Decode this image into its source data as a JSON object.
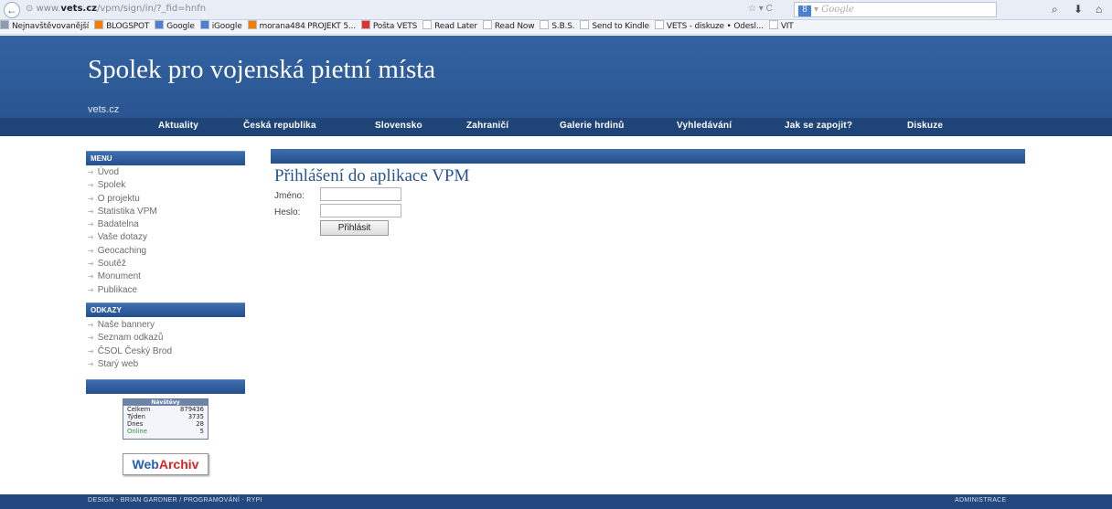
{
  "browser": {
    "back_glyph": "←",
    "url_prefix": "www.",
    "url_domain": "vets.cz",
    "url_rest": "/vpm/sign/in/?_fid=hnfn",
    "search_placeholder": "Google",
    "search_engine_glyph": "8",
    "star_icon": "star-icon",
    "reload_icon": "reload-icon",
    "bookmarks": [
      {
        "label": "Nejnavštěvovanější",
        "icon": "bookmarks-icon",
        "color": "#8a9bb5"
      },
      {
        "label": "BLOGSPOT",
        "icon": "blogger-icon",
        "color": "#f57d00"
      },
      {
        "label": "Google",
        "icon": "google-icon",
        "color": "#4c7fd6"
      },
      {
        "label": "iGoogle",
        "icon": "google-icon",
        "color": "#4c7fd6"
      },
      {
        "label": "morana484 PROJEKT 5...",
        "icon": "blogger-icon",
        "color": "#f57d00"
      },
      {
        "label": "Pošta VETS",
        "icon": "gmail-icon",
        "color": "#d33"
      },
      {
        "label": "Read Later",
        "icon": "page-icon",
        "color": "#ffffff"
      },
      {
        "label": "Read Now",
        "icon": "page-icon",
        "color": "#ffffff"
      },
      {
        "label": "S.B.S.",
        "icon": "page-icon",
        "color": "#ffffff"
      },
      {
        "label": "Send to Kindle",
        "icon": "page-icon",
        "color": "#ffffff"
      },
      {
        "label": "VETS - diskuze • Odesl...",
        "icon": "page-icon",
        "color": "#ffffff"
      },
      {
        "label": "VIT",
        "icon": "page-icon",
        "color": "#ffffff"
      }
    ]
  },
  "site": {
    "title": "Spolek pro vojenská pietní místa",
    "url": "vets.cz",
    "nav": [
      "Aktuality",
      "Česká republika",
      "Slovensko",
      "Zahraničí",
      "Galerie hrdinů",
      "Vyhledávání",
      "Jak se zapojit?",
      "Diskuze"
    ]
  },
  "sidebar": {
    "menu_title": "MENU",
    "menu_items": [
      "Úvod",
      "Spolek",
      "O projektu",
      "Statistika VPM",
      "Badatelna",
      "Vaše dotazy",
      "Geocaching",
      "Soutěž",
      "Monument",
      "Publikace"
    ],
    "links_title": "ODKAZY",
    "link_items": [
      "Naše bannery",
      "Seznam odkazů",
      "ČSOL Český Brod",
      "Starý web"
    ],
    "counter": {
      "title": "Návštěvy",
      "rows": [
        {
          "label": "Celkem",
          "value": "879436"
        },
        {
          "label": "Týden",
          "value": "3735"
        },
        {
          "label": "Dnes",
          "value": "28"
        },
        {
          "label": "Online",
          "value": "5"
        }
      ]
    },
    "webarchiv": {
      "part1": "Web",
      "part2": "Archiv"
    }
  },
  "main": {
    "title": "Přihlášení do aplikace VPM",
    "username_label": "Jméno:",
    "password_label": "Heslo:",
    "username_value": "",
    "password_value": "",
    "submit_label": "Přihlásit"
  },
  "footer": {
    "credits": "DESIGN - BRIAN GARDNER / PROGRAMOVÁNÍ - RYPI",
    "admin": "ADMINISTRACE"
  }
}
